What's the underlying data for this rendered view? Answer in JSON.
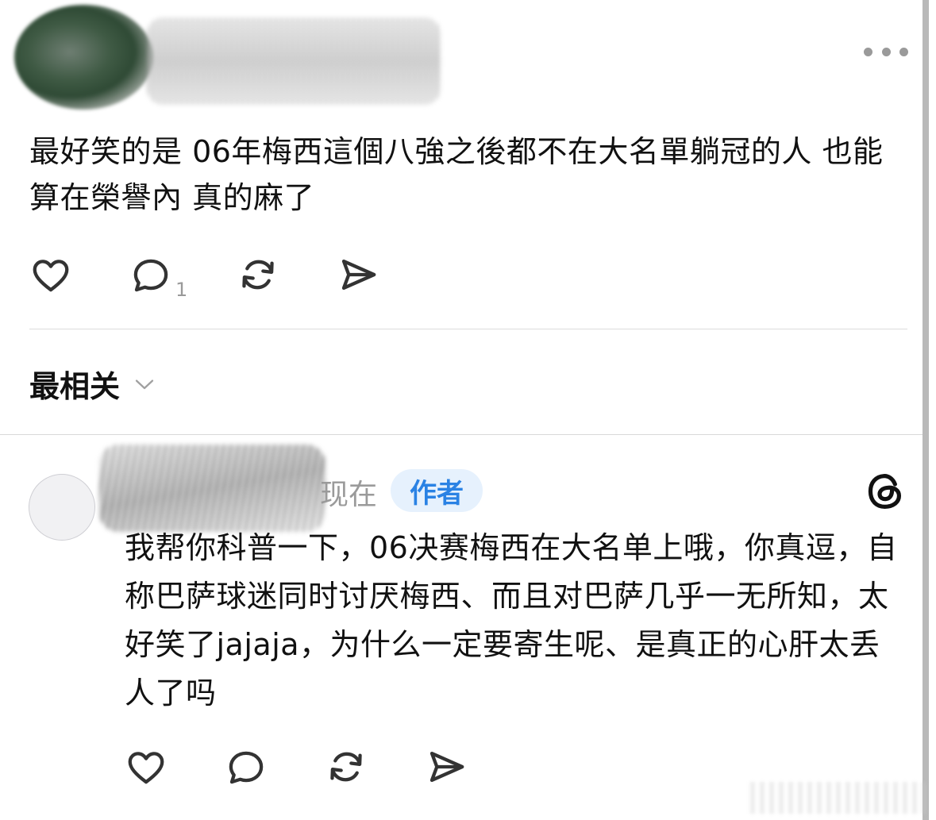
{
  "post": {
    "text": "最好笑的是 06年梅西這個八強之後都不在大名單躺冠的人 也能算在榮譽內 真的麻了",
    "reply_count": "1",
    "icons": {
      "more": "more-horizontal-icon",
      "like": "heart-icon",
      "reply": "comment-icon",
      "repost": "repost-icon",
      "share": "send-icon"
    }
  },
  "sort": {
    "label": "最相关",
    "icon": "chevron-down-icon"
  },
  "reply": {
    "time": "现在",
    "badge": "作者",
    "text": "我帮你科普一下，06决赛梅西在大名单上哦，你真逗，自称巴萨球迷同时讨厌梅西、而且对巴萨几乎一无所知，太好笑了jajaja，为什么一定要寄生呢、是真正的心肝太丢人了吗",
    "app_icon": "threads-logo-icon",
    "colors": {
      "badge_bg": "#e6f1fd",
      "badge_text": "#2a82e4"
    }
  }
}
